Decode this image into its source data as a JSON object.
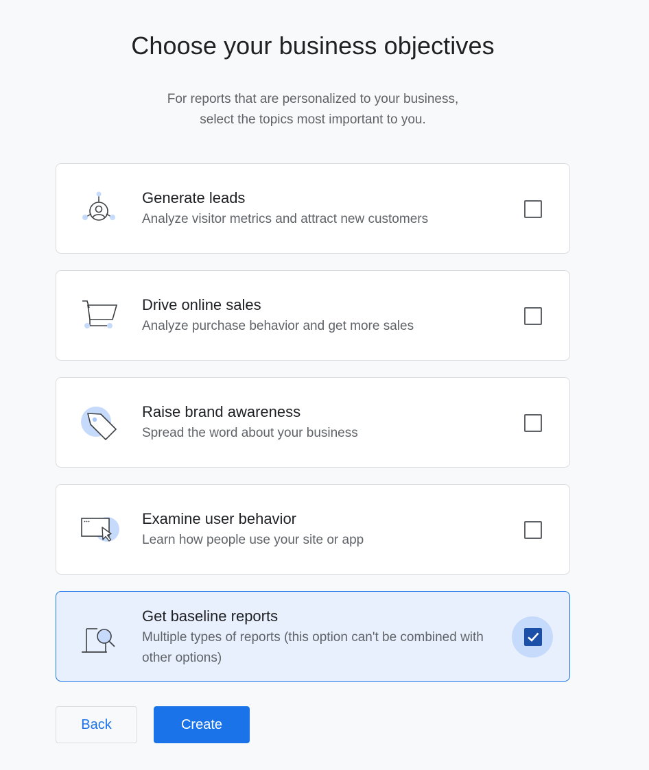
{
  "header": {
    "title": "Choose your business objectives",
    "subtitle_line1": "For reports that are personalized to your business,",
    "subtitle_line2": "select the topics most important to you."
  },
  "options": [
    {
      "title": "Generate leads",
      "description": "Analyze visitor metrics and attract new customers",
      "icon": "generate-leads-icon",
      "checked": false
    },
    {
      "title": "Drive online sales",
      "description": "Analyze purchase behavior and get more sales",
      "icon": "shopping-cart-icon",
      "checked": false
    },
    {
      "title": "Raise brand awareness",
      "description": "Spread the word about your business",
      "icon": "tag-icon",
      "checked": false
    },
    {
      "title": "Examine user behavior",
      "description": "Learn how people use your site or app",
      "icon": "browser-cursor-icon",
      "checked": false
    },
    {
      "title": "Get baseline reports",
      "description": "Multiple types of reports (this option can't be combined with other options)",
      "icon": "report-magnifier-icon",
      "checked": true
    }
  ],
  "actions": {
    "back_label": "Back",
    "create_label": "Create"
  },
  "colors": {
    "accent": "#1a73e8",
    "selected_bg": "#e8f0fe",
    "checkbox_checked": "#1b4fa8",
    "icon_highlight": "#c6dafc"
  }
}
